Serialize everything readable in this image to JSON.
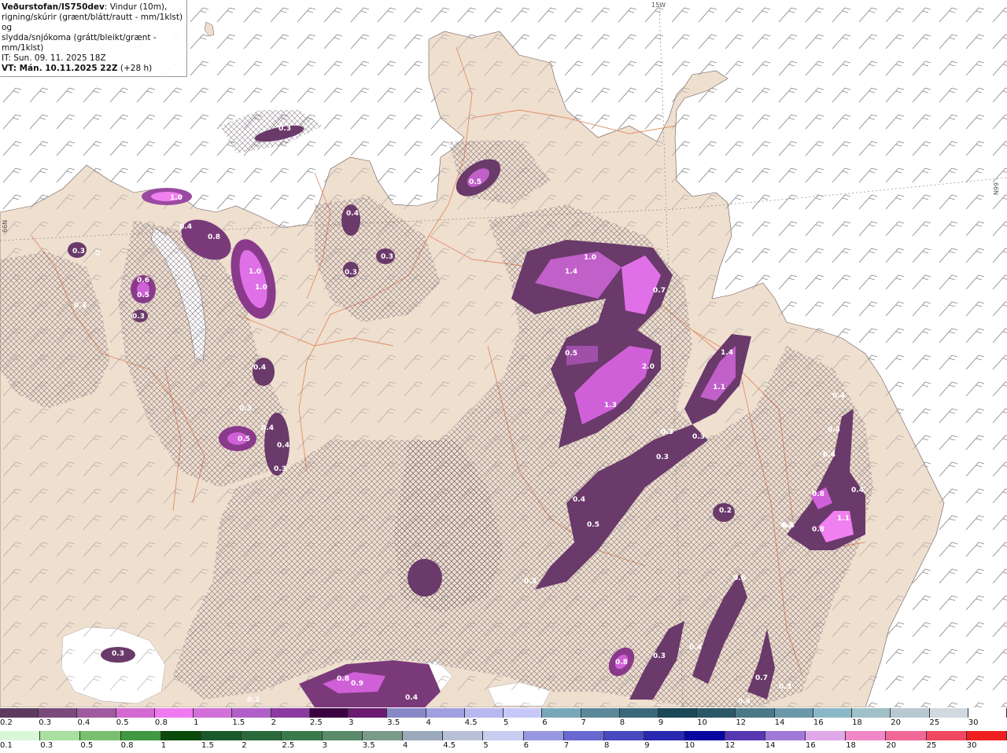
{
  "header": {
    "brand": "Veðurstofan/IS750dev",
    "line1_rest": ": Vindur (10m),",
    "line2": "rigning/skúrir (grænt/blátt/rautt - mm/1klst) og",
    "line3": "slydda/snjókoma (grátt/bleikt/grænt - mm/1klst)",
    "issue_time": "IT: Sun. 09. 11. 2025 18Z",
    "valid_time": "VT: Mán. 10.11.2025 22Z",
    "lead": "(+28 h)"
  },
  "grid_labels": {
    "lon_15w": "15W",
    "lat_66n_left": "66N",
    "lat_66n_right": "66N"
  },
  "colors": {
    "sea": "#ffffff",
    "land": "#efdfcf",
    "roads": "#e0855a",
    "hatch": "#5a4a5a",
    "wind_barbs": "#8a8a8a"
  },
  "precip_labels": [
    {
      "v": "0.3"
    },
    {
      "v": "1.0"
    },
    {
      "v": "0.4"
    },
    {
      "v": "0.8"
    },
    {
      "v": "1.0"
    },
    {
      "v": "1.0"
    },
    {
      "v": "0.3"
    },
    {
      "v": "0"
    },
    {
      "v": "0.6"
    },
    {
      "v": "0.5"
    },
    {
      "v": "0.3"
    },
    {
      "v": "0.3"
    },
    {
      "v": "0.4"
    },
    {
      "v": "0.3"
    },
    {
      "v": "0.3"
    },
    {
      "v": "0.5"
    },
    {
      "v": "1.0"
    },
    {
      "v": "1.4"
    },
    {
      "v": "0.7"
    },
    {
      "v": "0.5"
    },
    {
      "v": "2.0"
    },
    {
      "v": "1.3"
    },
    {
      "v": "1.4"
    },
    {
      "v": "1.1"
    },
    {
      "v": "0.4"
    },
    {
      "v": "0.3"
    },
    {
      "v": "0.5"
    },
    {
      "v": "0.4"
    },
    {
      "v": "0.4"
    },
    {
      "v": "0.3"
    },
    {
      "v": "0.3"
    },
    {
      "v": "0.3"
    },
    {
      "v": "0.3"
    },
    {
      "v": "0.4"
    },
    {
      "v": "0.5"
    },
    {
      "v": "0.4"
    },
    {
      "v": "0.3"
    },
    {
      "v": "0.2"
    },
    {
      "v": "0.3"
    },
    {
      "v": "0.4"
    },
    {
      "v": "0.4"
    },
    {
      "v": "0.8"
    },
    {
      "v": "0.4"
    },
    {
      "v": "1.1"
    },
    {
      "v": "0.8"
    },
    {
      "v": "0.4"
    },
    {
      "v": "0.6"
    },
    {
      "v": "0.4"
    },
    {
      "v": "0.3"
    },
    {
      "v": "0.8"
    },
    {
      "v": "0.7"
    },
    {
      "v": "0.3"
    },
    {
      "v": "0.4"
    },
    {
      "v": "0.8"
    },
    {
      "v": "0.9"
    },
    {
      "v": "0.4"
    },
    {
      "v": "0.3"
    },
    {
      "v": "0.2"
    }
  ],
  "legend_snow": {
    "labels": [
      "0.2",
      "0.3",
      "0.4",
      "0.5",
      "0.8",
      "1",
      "1.5",
      "2",
      "2.5",
      "3",
      "3.5",
      "4",
      "4.5",
      "5",
      "6",
      "7",
      "8",
      "9",
      "10",
      "12",
      "14",
      "16",
      "18",
      "20",
      "25",
      "30"
    ],
    "colors": [
      "#5e3a5e",
      "#7a4a7a",
      "#a05aa0",
      "#d26ad2",
      "#f07af0",
      "#d070d8",
      "#b060c8",
      "#8a3aa0",
      "#3a0040",
      "#6a1a70",
      "#8888c8",
      "#a0a0e0",
      "#b8b8f0",
      "#c8c8f8",
      "#78a8b8",
      "#5a8898",
      "#3a6878",
      "#1a4858",
      "#2a5868",
      "#4a7888",
      "#6a98a8",
      "#8ab8c8",
      "#a0c0c8",
      "#b8c8d0",
      "#d0d8e0",
      "#ffffff"
    ]
  },
  "legend_rain": {
    "labels": [
      "0.1",
      "0.3",
      "0.5",
      "0.8",
      "1",
      "1.5",
      "2",
      "2.5",
      "3",
      "3.5",
      "4",
      "4.5",
      "5",
      "6",
      "7",
      "8",
      "9",
      "10",
      "12",
      "14",
      "16",
      "18",
      "20",
      "25",
      "30"
    ],
    "colors": [
      "#d8f8d8",
      "#a8e0a0",
      "#78c070",
      "#409840",
      "#0a4a0a",
      "#1a5a2a",
      "#2a6a3a",
      "#3a7a4a",
      "#5a8a6a",
      "#7a9a8a",
      "#9aaabb",
      "#b8c0d8",
      "#c8ccf0",
      "#9898e0",
      "#6868d0",
      "#4848c0",
      "#2828b0",
      "#0808a0",
      "#5838b0",
      "#a078d8",
      "#e0a8e8",
      "#f088c8",
      "#f06898",
      "#f04860",
      "#f02020"
    ]
  }
}
